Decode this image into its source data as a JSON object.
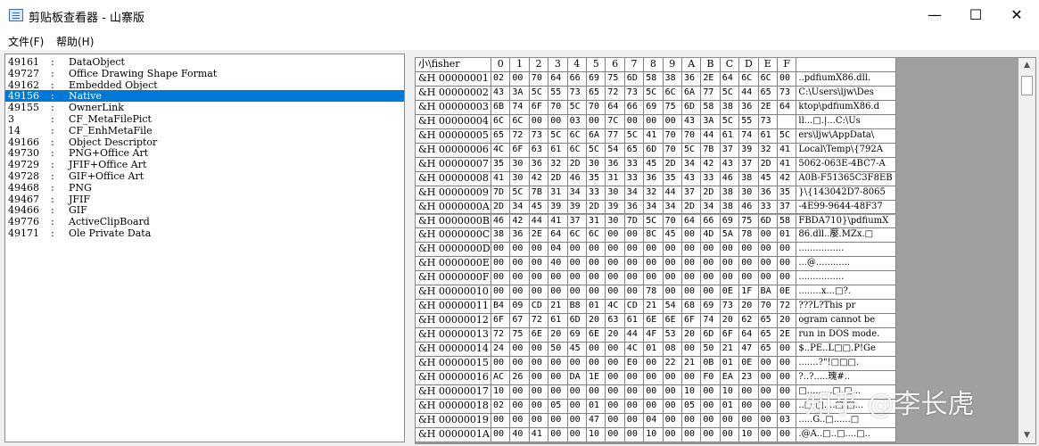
{
  "window": {
    "title": "剪贴板查看器 - 山寨版",
    "minimize": "—",
    "maximize": "☐",
    "close": "✕"
  },
  "menu": [
    "文件(F)",
    "帮助(H)"
  ],
  "formats": {
    "selected_index": 3,
    "items": [
      {
        "id": "49161",
        "name": "DataObject"
      },
      {
        "id": "49727",
        "name": "Office Drawing Shape Format"
      },
      {
        "id": "49162",
        "name": "Embedded Object"
      },
      {
        "id": "49156",
        "name": "Native"
      },
      {
        "id": "49155",
        "name": "OwnerLink"
      },
      {
        "id": "3",
        "name": "CF_MetaFilePict"
      },
      {
        "id": "14",
        "name": "CF_EnhMetaFile"
      },
      {
        "id": "49166",
        "name": "Object Descriptor"
      },
      {
        "id": "49730",
        "name": "PNG+Office Art"
      },
      {
        "id": "49729",
        "name": "JFIF+Office Art"
      },
      {
        "id": "49728",
        "name": "GIF+Office Art"
      },
      {
        "id": "49468",
        "name": "PNG"
      },
      {
        "id": "49467",
        "name": "JFIF"
      },
      {
        "id": "49466",
        "name": "GIF"
      },
      {
        "id": "49776",
        "name": "ActiveClipBoard"
      },
      {
        "id": "49171",
        "name": "Ole Private Data"
      }
    ]
  },
  "hex": {
    "corner": "小\\fisher",
    "columns": [
      "0",
      "1",
      "2",
      "3",
      "4",
      "5",
      "6",
      "7",
      "8",
      "9",
      "A",
      "B",
      "C",
      "D",
      "E",
      "F"
    ],
    "rows": [
      {
        "addr": "&H 00000001",
        "bytes": [
          "02",
          "00",
          "70",
          "64",
          "66",
          "69",
          "75",
          "6D",
          "58",
          "38",
          "36",
          "2E",
          "64",
          "6C",
          "6C",
          "00"
        ],
        "ascii": "..pdfiumX86.dll."
      },
      {
        "addr": "&H 00000002",
        "bytes": [
          "43",
          "3A",
          "5C",
          "55",
          "73",
          "65",
          "72",
          "73",
          "5C",
          "6C",
          "6A",
          "77",
          "5C",
          "44",
          "65",
          "73"
        ],
        "ascii": "C:\\Users\\ljw\\Des"
      },
      {
        "addr": "&H 00000003",
        "bytes": [
          "6B",
          "74",
          "6F",
          "70",
          "5C",
          "70",
          "64",
          "66",
          "69",
          "75",
          "6D",
          "58",
          "38",
          "36",
          "2E",
          "64"
        ],
        "ascii": "ktop\\pdfiumX86.d"
      },
      {
        "addr": "&H 00000004",
        "bytes": [
          "6C",
          "6C",
          "00",
          "00",
          "03",
          "00",
          "7C",
          "00",
          "00",
          "00",
          "43",
          "3A",
          "5C",
          "55",
          "73"
        ],
        "ascii": "ll...□.|...C:\\Us"
      },
      {
        "addr": "&H 00000005",
        "bytes": [
          "65",
          "72",
          "73",
          "5C",
          "6C",
          "6A",
          "77",
          "5C",
          "41",
          "70",
          "70",
          "44",
          "61",
          "74",
          "61",
          "5C"
        ],
        "ascii": "ers\\ljw\\AppData\\"
      },
      {
        "addr": "&H 00000006",
        "bytes": [
          "4C",
          "6F",
          "63",
          "61",
          "6C",
          "5C",
          "54",
          "65",
          "6D",
          "70",
          "5C",
          "7B",
          "37",
          "39",
          "32",
          "41"
        ],
        "ascii": "Local\\Temp\\{792A"
      },
      {
        "addr": "&H 00000007",
        "bytes": [
          "35",
          "30",
          "36",
          "32",
          "2D",
          "30",
          "36",
          "33",
          "45",
          "2D",
          "34",
          "42",
          "43",
          "37",
          "2D",
          "41"
        ],
        "ascii": "5062-063E-4BC7-A"
      },
      {
        "addr": "&H 00000008",
        "bytes": [
          "41",
          "30",
          "42",
          "2D",
          "46",
          "35",
          "31",
          "33",
          "36",
          "35",
          "43",
          "33",
          "46",
          "38",
          "45",
          "42"
        ],
        "ascii": "A0B-F51365C3F8EB"
      },
      {
        "addr": "&H 00000009",
        "bytes": [
          "7D",
          "5C",
          "7B",
          "31",
          "34",
          "33",
          "30",
          "34",
          "32",
          "44",
          "37",
          "2D",
          "38",
          "30",
          "36",
          "35"
        ],
        "ascii": "}\\{143042D7-8065"
      },
      {
        "addr": "&H 0000000A",
        "bytes": [
          "2D",
          "34",
          "45",
          "39",
          "39",
          "2D",
          "39",
          "36",
          "34",
          "34",
          "2D",
          "34",
          "38",
          "46",
          "33",
          "37"
        ],
        "ascii": "-4E99-9644-48F37"
      },
      {
        "addr": "&H 0000000B",
        "bytes": [
          "46",
          "42",
          "44",
          "41",
          "37",
          "31",
          "30",
          "7D",
          "5C",
          "70",
          "64",
          "66",
          "69",
          "75",
          "6D",
          "58"
        ],
        "ascii": "FBDA710}\\pdfiumX"
      },
      {
        "addr": "&H 0000000C",
        "bytes": [
          "38",
          "36",
          "2E",
          "64",
          "6C",
          "6C",
          "00",
          "00",
          "8C",
          "45",
          "00",
          "4D",
          "5A",
          "78",
          "00",
          "01"
        ],
        "ascii": "86.dll..嬮.MZx.□"
      },
      {
        "addr": "&H 0000000D",
        "bytes": [
          "00",
          "00",
          "00",
          "04",
          "00",
          "00",
          "00",
          "00",
          "00",
          "00",
          "00",
          "00",
          "00",
          "00",
          "00",
          "00"
        ],
        "ascii": "................"
      },
      {
        "addr": "&H 0000000E",
        "bytes": [
          "00",
          "00",
          "00",
          "40",
          "00",
          "00",
          "00",
          "00",
          "00",
          "00",
          "00",
          "00",
          "00",
          "00",
          "00",
          "00"
        ],
        "ascii": "...@............"
      },
      {
        "addr": "&H 0000000F",
        "bytes": [
          "00",
          "00",
          "00",
          "00",
          "00",
          "00",
          "00",
          "00",
          "00",
          "00",
          "00",
          "00",
          "00",
          "00",
          "00",
          "00"
        ],
        "ascii": "................"
      },
      {
        "addr": "&H 00000010",
        "bytes": [
          "00",
          "00",
          "00",
          "00",
          "00",
          "00",
          "00",
          "00",
          "78",
          "00",
          "00",
          "00",
          "0E",
          "1F",
          "BA",
          "0E"
        ],
        "ascii": "........x...□?."
      },
      {
        "addr": "&H 00000011",
        "bytes": [
          "B4",
          "09",
          "CD",
          "21",
          "B8",
          "01",
          "4C",
          "CD",
          "21",
          "54",
          "68",
          "69",
          "73",
          "20",
          "70",
          "72"
        ],
        "ascii": "???L?This pr"
      },
      {
        "addr": "&H 00000012",
        "bytes": [
          "6F",
          "67",
          "72",
          "61",
          "6D",
          "20",
          "63",
          "61",
          "6E",
          "6E",
          "6F",
          "74",
          "20",
          "62",
          "65",
          "20"
        ],
        "ascii": "ogram cannot be "
      },
      {
        "addr": "&H 00000013",
        "bytes": [
          "72",
          "75",
          "6E",
          "20",
          "69",
          "6E",
          "20",
          "44",
          "4F",
          "53",
          "20",
          "6D",
          "6F",
          "64",
          "65",
          "2E"
        ],
        "ascii": "run in DOS mode."
      },
      {
        "addr": "&H 00000014",
        "bytes": [
          "24",
          "00",
          "00",
          "50",
          "45",
          "00",
          "00",
          "4C",
          "01",
          "08",
          "00",
          "50",
          "21",
          "47",
          "65",
          "00"
        ],
        "ascii": "$..PE..L□□.P!Ge"
      },
      {
        "addr": "&H 00000015",
        "bytes": [
          "00",
          "00",
          "00",
          "00",
          "00",
          "00",
          "00",
          "E0",
          "00",
          "22",
          "21",
          "0B",
          "01",
          "0E",
          "00",
          "00"
        ],
        "ascii": ".......?\"!□□□."
      },
      {
        "addr": "&H 00000016",
        "bytes": [
          "AC",
          "26",
          "00",
          "00",
          "DA",
          "1E",
          "00",
          "00",
          "00",
          "00",
          "00",
          "F0",
          "EA",
          "23",
          "00",
          "00"
        ],
        "ascii": "?..?.....瑰#.."
      },
      {
        "addr": "&H 00000017",
        "bytes": [
          "10",
          "00",
          "00",
          "00",
          "00",
          "00",
          "00",
          "00",
          "00",
          "00",
          "10",
          "00",
          "10",
          "00",
          "00",
          "00"
        ],
        "ascii": "□.........□.□..."
      },
      {
        "addr": "&H 00000018",
        "bytes": [
          "02",
          "00",
          "00",
          "05",
          "00",
          "01",
          "00",
          "00",
          "00",
          "00",
          "05",
          "00",
          "01",
          "00",
          "00",
          "00"
        ],
        "ascii": "..□.□....□.□..."
      },
      {
        "addr": "&H 00000019",
        "bytes": [
          "00",
          "00",
          "00",
          "00",
          "00",
          "47",
          "00",
          "00",
          "04",
          "00",
          "00",
          "00",
          "00",
          "00",
          "00",
          "03"
        ],
        "ascii": ".....G..□......□"
      },
      {
        "addr": "&H 0000001A",
        "bytes": [
          "00",
          "40",
          "41",
          "00",
          "00",
          "10",
          "00",
          "00",
          "10",
          "00",
          "00",
          "00",
          "00",
          "10",
          "00",
          "00"
        ],
        "ascii": ".@A..□..□....□.."
      }
    ]
  },
  "watermark": "知乎 @李长虎",
  "icons": {
    "app": "clipboard-icon",
    "scroll_up": "▲",
    "scroll_down": "▼"
  }
}
